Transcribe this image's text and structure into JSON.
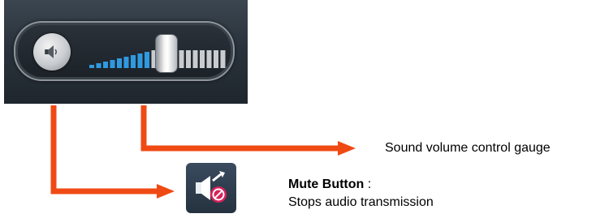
{
  "annotations": {
    "gauge": {
      "label": "Sound volume control gauge"
    },
    "mute": {
      "title": "Mute Button",
      "separator": " :",
      "description": "Stops audio transmission"
    }
  },
  "volume": {
    "level": 0.45
  },
  "icons": {
    "speaker": "speaker-icon",
    "mute": "speaker-muted-icon"
  },
  "colors": {
    "arrow": "#f04a14",
    "gauge_active": "#2f9ae0",
    "gauge_inactive": "#c8ccd0"
  }
}
